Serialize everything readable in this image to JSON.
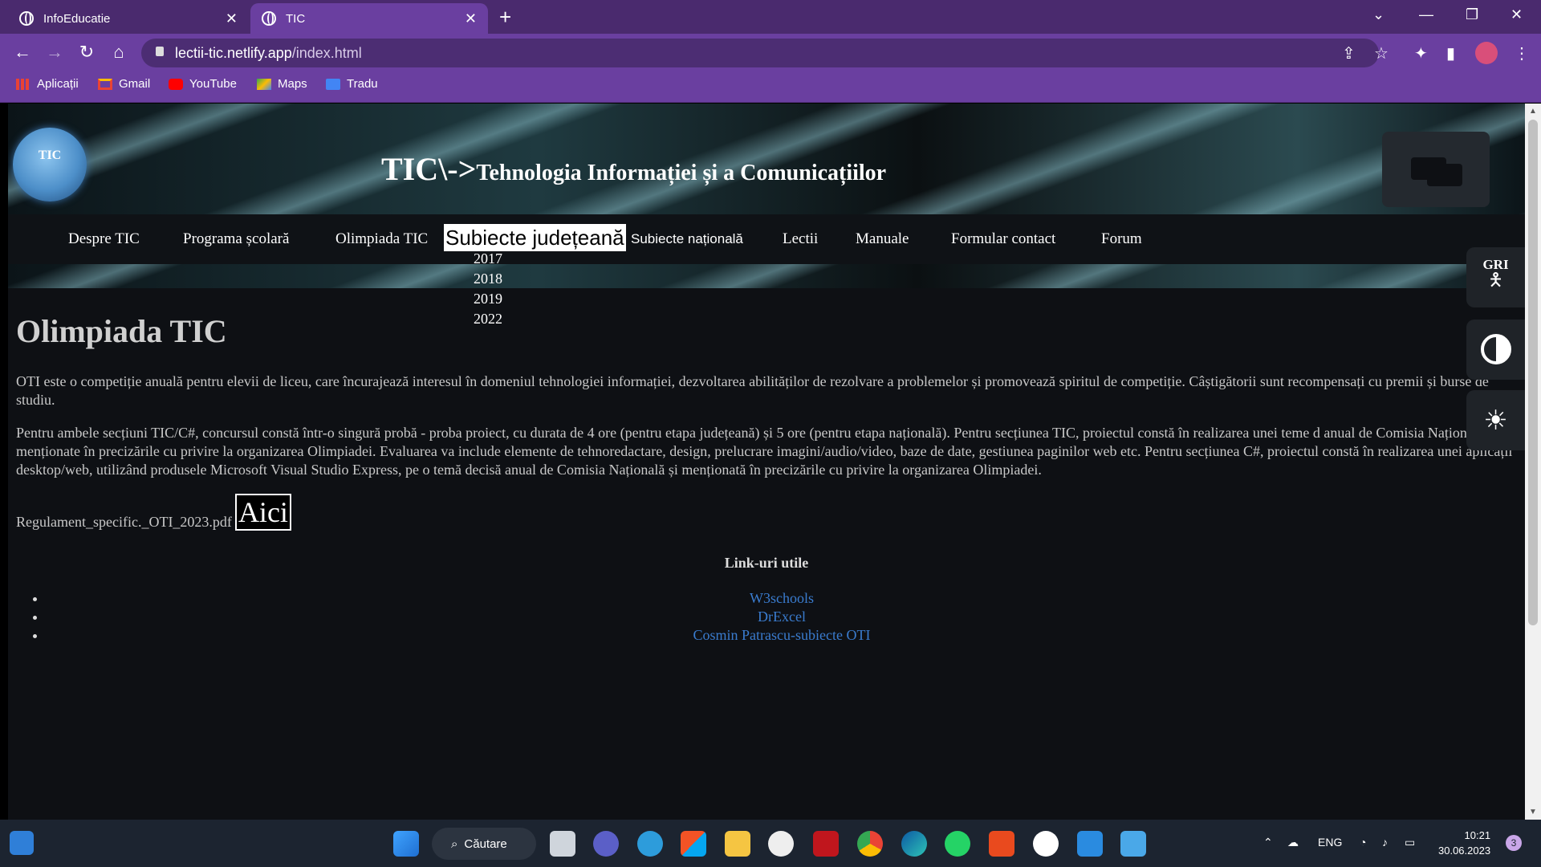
{
  "browser": {
    "tabs": [
      {
        "title": "InfoEducatie",
        "active": false
      },
      {
        "title": "TIC",
        "active": true
      }
    ],
    "url_host": "lectii-tic.netlify.app",
    "url_path": "/index.html",
    "bookmarks": [
      "Aplicații",
      "Gmail",
      "YouTube",
      "Maps",
      "Tradu"
    ]
  },
  "site": {
    "logo_text": "TIC",
    "title_prefix": "TIC\\->",
    "title_main": "Tehnologia Informației și a Comunicațiilor",
    "menu": [
      "Despre TIC",
      "Programa școlară",
      "Olimpiada TIC",
      "Subiecte județeană",
      "Subiecte națională",
      "Lectii",
      "Manuale",
      "Formular contact",
      "Forum"
    ],
    "dropdown_years": [
      "2017",
      "2018",
      "2019",
      "2022"
    ],
    "side_buttons": {
      "gri_label": "GRI"
    }
  },
  "content": {
    "heading": "Olimpiada TIC",
    "paragraph1": "OTI este o competiție anuală pentru elevii de liceu, care încurajează interesul în domeniul tehnologiei informației, dezvoltarea abilităților de rezolvare a problemelor și promovează spiritul de competiție. Câștigătorii sunt recompensați cu premii și burse de studiu.",
    "paragraph2": "Pentru ambele secțiuni TIC/C#, concursul constă într-o singură probă - proba proiect, cu durata de 4 ore (pentru etapa județeană) și 5 ore (pentru etapa națională). Pentru secțiunea TIC, proiectul constă în realizarea unei teme d anual de Comisia Națională și menționate în precizările cu privire la organizarea Olimpiadei. Evaluarea va include elemente de tehnoredactare, design, prelucrare imagini/audio/video, baze de date, gestiunea paginilor web etc. Pentru secțiunea C#, proiectul constă în realizarea unei aplicații desktop/web, utilizând produsele Microsoft Visual Studio Express, pe o temă decisă anual de Comisia Națională și menționată în precizările cu privire la organizarea Olimpiadei.",
    "regulament_file": "Regulament_specific._OTI_2023.pdf",
    "aici_label": "Aici",
    "links_title": "Link-uri utile",
    "links": [
      "W3schools",
      "DrExcel",
      "Cosmin Patrascu-subiecte OTI"
    ]
  },
  "taskbar": {
    "search_label": "Căutare",
    "language": "ENG",
    "time": "10:21",
    "date": "30.06.2023",
    "notifications": "3"
  },
  "colors": {
    "tab_bar": "#4a2a6e",
    "toolbar": "#6a3fa0",
    "page_bg": "#0e1014",
    "link": "#3a7ccf"
  }
}
